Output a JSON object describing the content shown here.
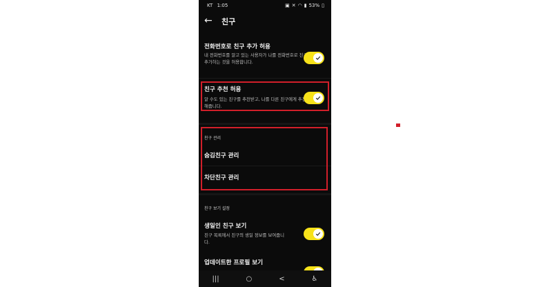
{
  "status_bar": {
    "carrier": "KT",
    "time": "1:05",
    "battery": "53%",
    "icons": [
      "notification-icon",
      "mute-icon",
      "wifi-icon",
      "signal-icon",
      "battery-icon"
    ]
  },
  "app_bar": {
    "back_icon": "arrow-left-icon",
    "title": "친구"
  },
  "settings": {
    "phone_add": {
      "title": "전화번호로 친구 추가 허용",
      "desc": "내 전화번호를 알고 있는 사용자가 나를 전화번호로 친구 추가하는 것을 허용합니다.",
      "enabled": true
    },
    "recommend": {
      "title": "친구 추천 허용",
      "desc": "알 수도 있는 친구를 추천받고, 나를 다른 친구에게 추천해줍니다.",
      "enabled": true
    },
    "manage": {
      "section_label": "친구 관리",
      "hidden": "숨김친구 관리",
      "blocked": "차단친구 관리"
    },
    "view": {
      "section_label": "친구 보기 설정",
      "birthday": {
        "title": "생일인 친구 보기",
        "desc": "친구 목록에서 친구의 생일 정보를 보여줍니다.",
        "enabled": true
      },
      "updated_profile": {
        "title": "업데이트한 프로필 보기",
        "enabled": true
      }
    }
  },
  "bottom_nav": {
    "icons": [
      "recent-apps-icon",
      "home-icon",
      "back-nav-icon",
      "accessibility-icon"
    ],
    "glyphs": [
      "|||",
      "○",
      "<",
      "♿"
    ]
  },
  "colors": {
    "accent": "#f7e21a",
    "highlight": "#d21f2a",
    "background": "#0b0b0b"
  }
}
